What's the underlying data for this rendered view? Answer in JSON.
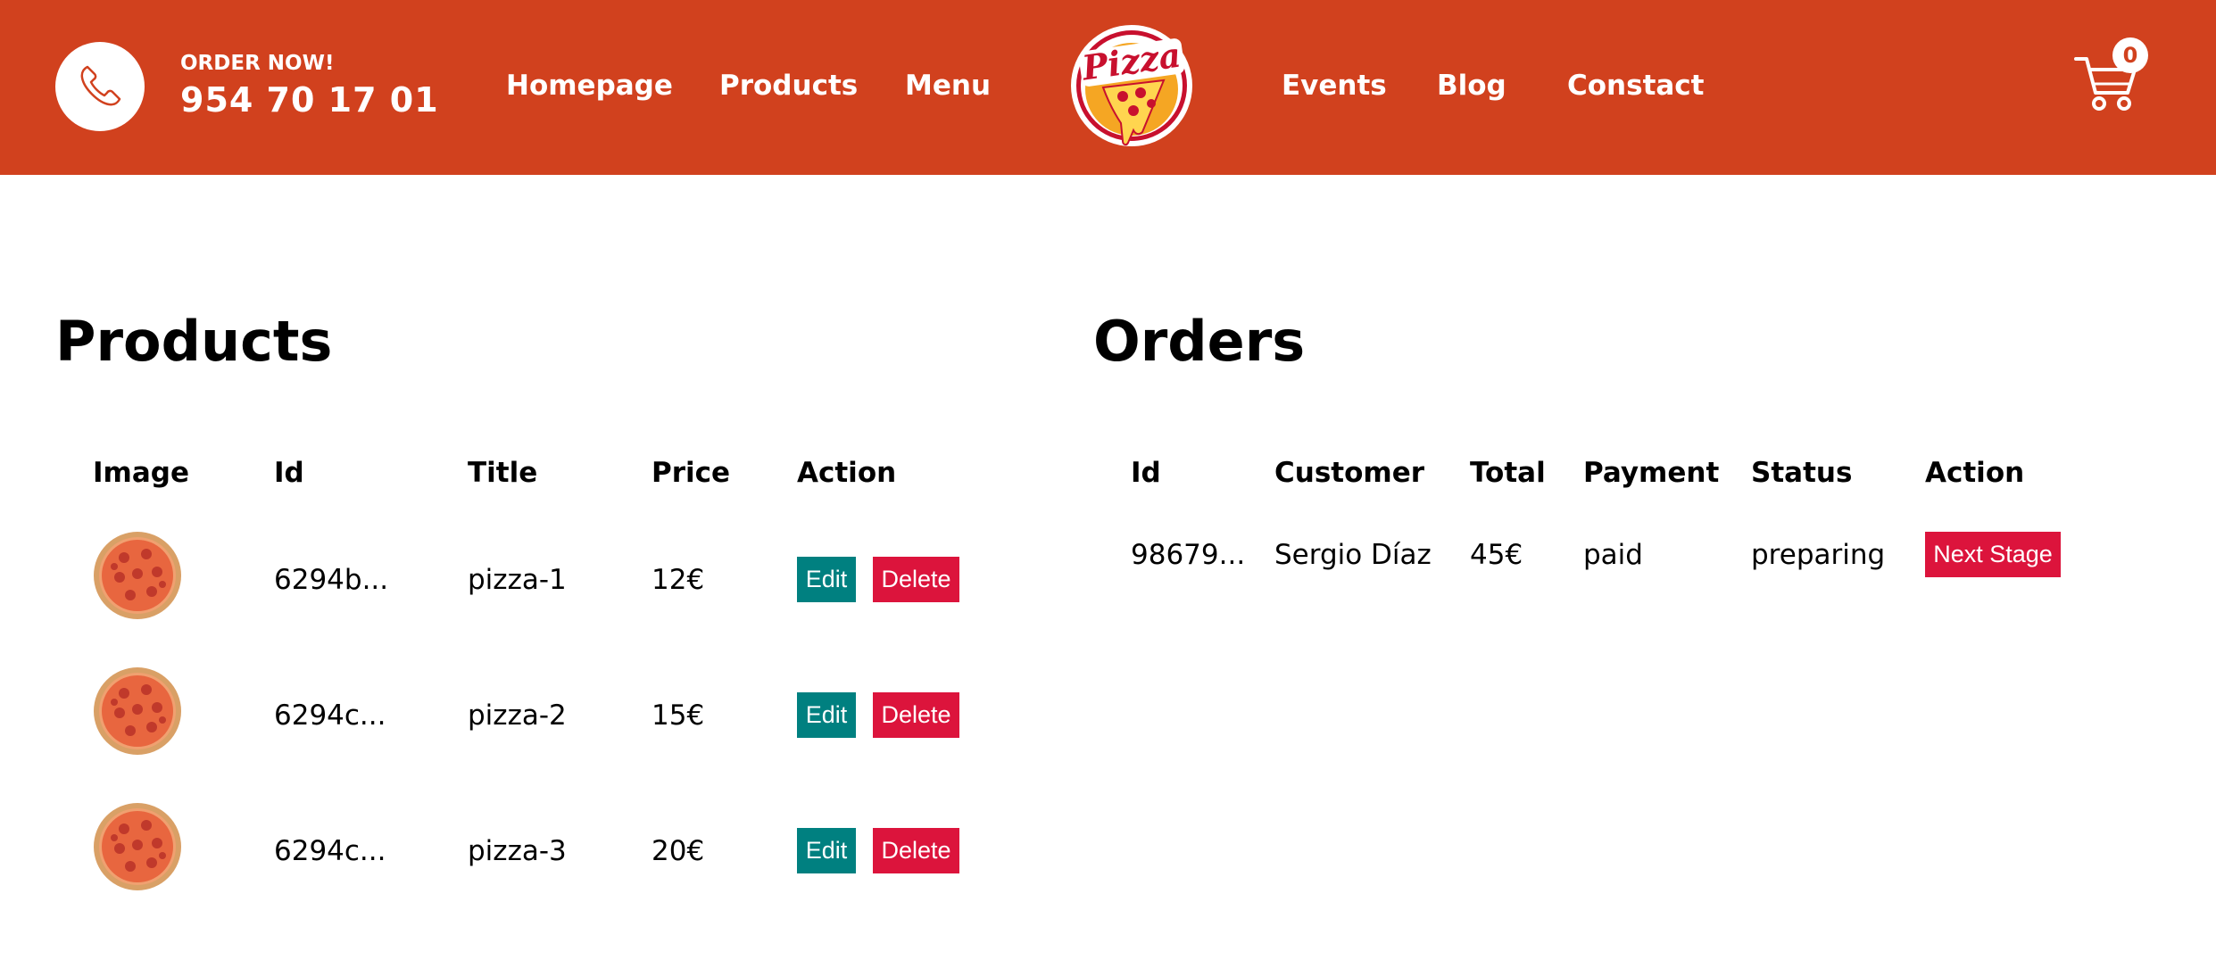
{
  "navbar": {
    "order_label": "ORDER NOW!",
    "phone": "954 70 17 01",
    "links_left": [
      "Homepage",
      "Products",
      "Menu"
    ],
    "links_right": [
      "Events",
      "Blog",
      "Constact"
    ],
    "logo_text": "Pizza",
    "cart_count": "0",
    "brand_color": "#d1411e"
  },
  "products": {
    "title": "Products",
    "headers": [
      "Image",
      "Id",
      "Title",
      "Price",
      "Action"
    ],
    "rows": [
      {
        "id": "6294b...",
        "title": "pizza-1",
        "price": "12€"
      },
      {
        "id": "6294c...",
        "title": "pizza-2",
        "price": "15€"
      },
      {
        "id": "6294c...",
        "title": "pizza-3",
        "price": "20€"
      }
    ],
    "edit_label": "Edit",
    "delete_label": "Delete",
    "edit_color": "#008080",
    "delete_color": "#dc143c"
  },
  "orders": {
    "title": "Orders",
    "headers": [
      "Id",
      "Customer",
      "Total",
      "Payment",
      "Status",
      "Action"
    ],
    "rows": [
      {
        "id": "98679...",
        "customer": "Sergio Díaz",
        "total": "45€",
        "payment": "paid",
        "status": "preparing"
      }
    ],
    "next_stage_label": "Next Stage"
  }
}
